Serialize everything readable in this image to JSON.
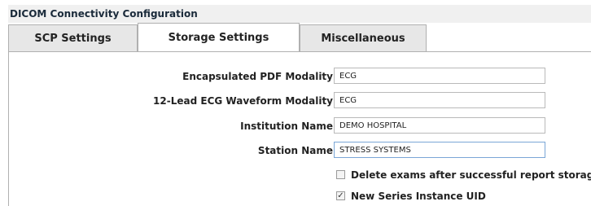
{
  "window": {
    "title": "DICOM Connectivity Configuration"
  },
  "tabs": [
    {
      "label": "SCP Settings",
      "active": false
    },
    {
      "label": "Storage Settings",
      "active": true
    },
    {
      "label": "Miscellaneous",
      "active": false
    }
  ],
  "fields": [
    {
      "label": "Encapsulated PDF Modality",
      "value": "ECG"
    },
    {
      "label": "12-Lead ECG Waveform Modality",
      "value": "ECG"
    },
    {
      "label": "Institution Name",
      "value": "DEMO HOSPITAL"
    },
    {
      "label": "Station Name",
      "value": "STRESS SYSTEMS"
    }
  ],
  "checkboxes": [
    {
      "label": "Delete exams after successful report storage",
      "checked": false,
      "mark": ""
    },
    {
      "label": "New Series Instance UID",
      "checked": true,
      "mark": "✓"
    }
  ]
}
